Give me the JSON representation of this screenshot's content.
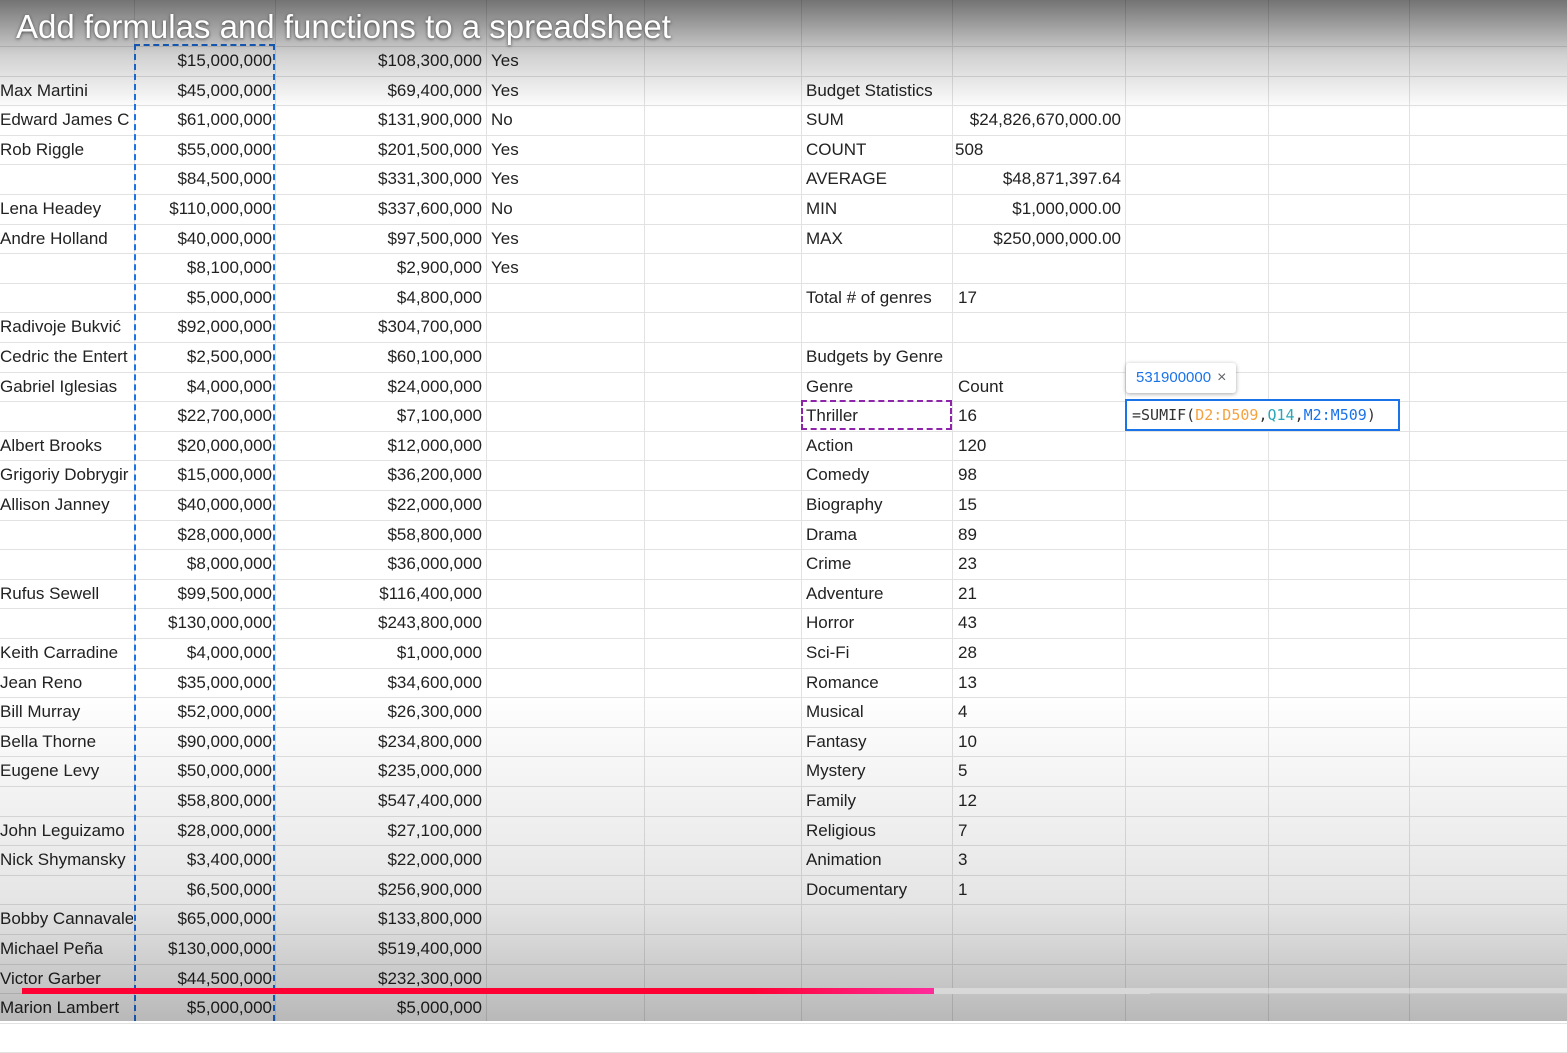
{
  "video": {
    "title": "Add formulas and functions to a spreadsheet",
    "progress_played": 0.59,
    "progress_buffered": 0.73,
    "progress_color": "#ff0033"
  },
  "sheet": {
    "left_rows": [
      {
        "name": "",
        "budget": "$15,000,000",
        "gross": "$108,300,000",
        "flag": "Yes"
      },
      {
        "name": "Max Martini",
        "budget": "$45,000,000",
        "gross": "$69,400,000",
        "flag": "Yes"
      },
      {
        "name": "Edward James C",
        "budget": "$61,000,000",
        "gross": "$131,900,000",
        "flag": "No"
      },
      {
        "name": "Rob Riggle",
        "budget": "$55,000,000",
        "gross": "$201,500,000",
        "flag": "Yes"
      },
      {
        "name": "",
        "budget": "$84,500,000",
        "gross": "$331,300,000",
        "flag": "Yes"
      },
      {
        "name": "Lena Headey",
        "budget": "$110,000,000",
        "gross": "$337,600,000",
        "flag": "No"
      },
      {
        "name": "Andre Holland",
        "budget": "$40,000,000",
        "gross": "$97,500,000",
        "flag": "Yes"
      },
      {
        "name": "",
        "budget": "$8,100,000",
        "gross": "$2,900,000",
        "flag": "Yes"
      },
      {
        "name": "",
        "budget": "$5,000,000",
        "gross": "$4,800,000",
        "flag": ""
      },
      {
        "name": "Radivoje Bukvić",
        "budget": "$92,000,000",
        "gross": "$304,700,000",
        "flag": ""
      },
      {
        "name": "Cedric the Entert",
        "budget": "$2,500,000",
        "gross": "$60,100,000",
        "flag": ""
      },
      {
        "name": "Gabriel Iglesias",
        "budget": "$4,000,000",
        "gross": "$24,000,000",
        "flag": ""
      },
      {
        "name": "",
        "budget": "$22,700,000",
        "gross": "$7,100,000",
        "flag": ""
      },
      {
        "name": "Albert Brooks",
        "budget": "$20,000,000",
        "gross": "$12,000,000",
        "flag": ""
      },
      {
        "name": "Grigoriy Dobrygir",
        "budget": "$15,000,000",
        "gross": "$36,200,000",
        "flag": ""
      },
      {
        "name": "Allison Janney",
        "budget": "$40,000,000",
        "gross": "$22,000,000",
        "flag": ""
      },
      {
        "name": "",
        "budget": "$28,000,000",
        "gross": "$58,800,000",
        "flag": ""
      },
      {
        "name": "",
        "budget": "$8,000,000",
        "gross": "$36,000,000",
        "flag": ""
      },
      {
        "name": "Rufus Sewell",
        "budget": "$99,500,000",
        "gross": "$116,400,000",
        "flag": ""
      },
      {
        "name": "",
        "budget": "$130,000,000",
        "gross": "$243,800,000",
        "flag": ""
      },
      {
        "name": "Keith Carradine",
        "budget": "$4,000,000",
        "gross": "$1,000,000",
        "flag": ""
      },
      {
        "name": "Jean Reno",
        "budget": "$35,000,000",
        "gross": "$34,600,000",
        "flag": ""
      },
      {
        "name": "Bill Murray",
        "budget": "$52,000,000",
        "gross": "$26,300,000",
        "flag": ""
      },
      {
        "name": "Bella Thorne",
        "budget": "$90,000,000",
        "gross": "$234,800,000",
        "flag": ""
      },
      {
        "name": "Eugene Levy",
        "budget": "$50,000,000",
        "gross": "$235,000,000",
        "flag": ""
      },
      {
        "name": "",
        "budget": "$58,800,000",
        "gross": "$547,400,000",
        "flag": ""
      },
      {
        "name": "John Leguizamo",
        "budget": "$28,000,000",
        "gross": "$27,100,000",
        "flag": ""
      },
      {
        "name": "Nick Shymansky",
        "budget": "$3,400,000",
        "gross": "$22,000,000",
        "flag": ""
      },
      {
        "name": "",
        "budget": "$6,500,000",
        "gross": "$256,900,000",
        "flag": ""
      },
      {
        "name": "Bobby Cannavale",
        "budget": "$65,000,000",
        "gross": "$133,800,000",
        "flag": ""
      },
      {
        "name": "Michael Peña",
        "budget": "$130,000,000",
        "gross": "$519,400,000",
        "flag": ""
      },
      {
        "name": "Victor Garber",
        "budget": "$44,500,000",
        "gross": "$232,300,000",
        "flag": ""
      },
      {
        "name": "Marion Lambert",
        "budget": "$5,000,000",
        "gross": "$5,000,000",
        "flag": ""
      }
    ],
    "stats": {
      "heading": "Budget Statistics",
      "rows": [
        {
          "label": "SUM",
          "value": "$24,826,670,000.00"
        },
        {
          "label": "COUNT",
          "value": "508"
        },
        {
          "label": "AVERAGE",
          "value": "$48,871,397.64"
        },
        {
          "label": "MIN",
          "value": "$1,000,000.00"
        },
        {
          "label": "MAX",
          "value": "$250,000,000.00"
        }
      ],
      "total_genres_label": "Total # of genres",
      "total_genres_value": "17"
    },
    "genres": {
      "heading": "Budgets by Genre",
      "col_genre": "Genre",
      "col_count": "Count",
      "rows": [
        {
          "genre": "Thriller",
          "count": "16"
        },
        {
          "genre": "Action",
          "count": "120"
        },
        {
          "genre": "Comedy",
          "count": "98"
        },
        {
          "genre": "Biography",
          "count": "15"
        },
        {
          "genre": "Drama",
          "count": "89"
        },
        {
          "genre": "Crime",
          "count": "23"
        },
        {
          "genre": "Adventure",
          "count": "21"
        },
        {
          "genre": "Horror",
          "count": "43"
        },
        {
          "genre": "Sci-Fi",
          "count": "28"
        },
        {
          "genre": "Romance",
          "count": "13"
        },
        {
          "genre": "Musical",
          "count": "4"
        },
        {
          "genre": "Fantasy",
          "count": "10"
        },
        {
          "genre": "Mystery",
          "count": "5"
        },
        {
          "genre": "Family",
          "count": "12"
        },
        {
          "genre": "Religious",
          "count": "7"
        },
        {
          "genre": "Animation",
          "count": "3"
        },
        {
          "genre": "Documentary",
          "count": "1"
        }
      ]
    },
    "formula": {
      "result_preview": "531900000",
      "close_glyph": "×",
      "parts": [
        {
          "text": "=SUMIF(",
          "color": "#333333"
        },
        {
          "text": "D2:D509",
          "color": "#f4a340"
        },
        {
          "text": ",",
          "color": "#333333"
        },
        {
          "text": "Q14",
          "color": "#2aa6b8"
        },
        {
          "text": ",",
          "color": "#333333"
        },
        {
          "text": "M2:M509",
          "color": "#1a73e8"
        },
        {
          "text": ")",
          "color": "#333333"
        }
      ]
    },
    "colors": {
      "copy_range_border": "#1a73e8",
      "reference_border": "#8e24aa",
      "active_cell_border": "#1a73e8"
    }
  }
}
